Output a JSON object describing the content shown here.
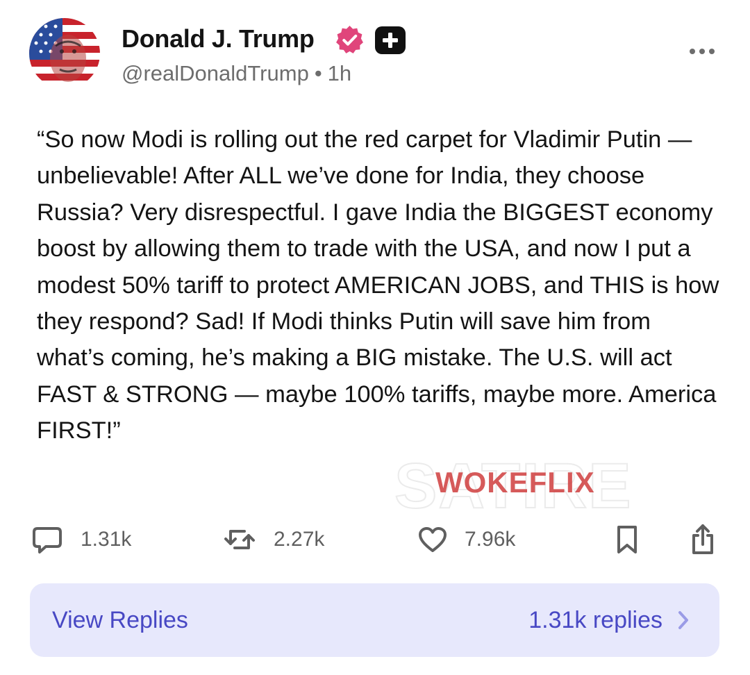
{
  "post": {
    "author": {
      "display_name": "Donald J. Trump",
      "handle": "@realDonaldTrump",
      "time": "1h",
      "separator": "•",
      "verified_icon": "verified-badge-icon",
      "extra_badge_icon": "plus-badge-icon"
    },
    "menu_icon": "more-horizontal-icon",
    "text": "“So now Modi is rolling out the red carpet for Vladimir Putin — unbelievable! After ALL we’ve done for India, they choose Russia? Very disrespectful. I gave India the BIGGEST economy boost by allowing them to trade with the USA, and now I put a modest 50% tariff to protect AMERICAN JOBS, and THIS is how they respond? Sad! If Modi thinks Putin will save him from what’s coming, he’s making a BIG mistake. The U.S. will act FAST & STRONG — maybe 100% tariffs, maybe more. America FIRST!”",
    "watermark": {
      "background_text": "SATIRE",
      "foreground_text": "WOKEFLIX"
    },
    "actions": {
      "replies": {
        "icon": "comment-icon",
        "count": "1.31k"
      },
      "reposts": {
        "icon": "repost-icon",
        "count": "2.27k"
      },
      "likes": {
        "icon": "heart-icon",
        "count": "7.96k"
      },
      "bookmark_icon": "bookmark-icon",
      "share_icon": "share-icon"
    },
    "view_replies": {
      "label": "View Replies",
      "count_text": "1.31k replies",
      "chevron_icon": "chevron-right-icon"
    }
  },
  "colors": {
    "verified": "#e0457b",
    "accent": "#4848c4",
    "replies_bg": "#e7e8fc",
    "watermark": "#cf3e3e"
  }
}
